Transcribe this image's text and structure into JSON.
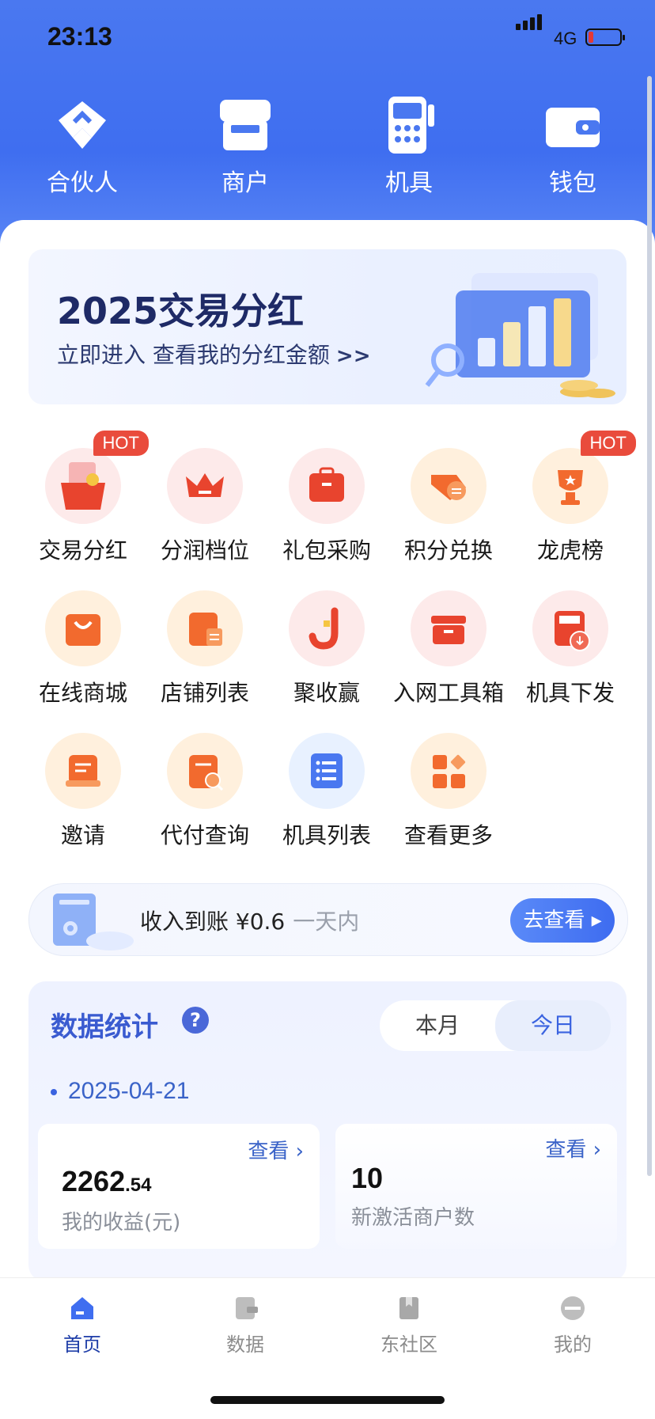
{
  "status_bar": {
    "time": "23:13",
    "network": "4G"
  },
  "top_nav": [
    {
      "label": "合伙人",
      "icon": "partner-icon"
    },
    {
      "label": "商户",
      "icon": "merchant-icon"
    },
    {
      "label": "机具",
      "icon": "pos-terminal-icon"
    },
    {
      "label": "钱包",
      "icon": "wallet-icon"
    }
  ],
  "banner": {
    "title": "2025交易分红",
    "subtitle": "立即进入 查看我的分红金额",
    "arrow": ">>"
  },
  "grid": [
    {
      "label": "交易分红",
      "badge": "HOT",
      "icon": "red-envelope-icon"
    },
    {
      "label": "分润档位",
      "icon": "crown-icon"
    },
    {
      "label": "礼包采购",
      "icon": "gift-bag-icon"
    },
    {
      "label": "积分兑换",
      "icon": "exchange-icon"
    },
    {
      "label": "龙虎榜",
      "badge": "HOT",
      "icon": "trophy-icon"
    },
    {
      "label": "在线商城",
      "icon": "shopping-bag-icon"
    },
    {
      "label": "店铺列表",
      "icon": "store-list-icon"
    },
    {
      "label": "聚收赢",
      "icon": "j-logo-icon"
    },
    {
      "label": "入网工具箱",
      "icon": "toolbox-icon"
    },
    {
      "label": "机具下发",
      "icon": "device-dispatch-icon"
    },
    {
      "label": "邀请",
      "icon": "invite-icon"
    },
    {
      "label": "代付查询",
      "icon": "payment-query-icon"
    },
    {
      "label": "机具列表",
      "icon": "device-list-icon"
    },
    {
      "label": "查看更多",
      "icon": "more-apps-icon"
    }
  ],
  "notice": {
    "text": "收入到账 ¥0.6",
    "sub": "一天内",
    "button": "去查看"
  },
  "stats": {
    "title": "数据统计",
    "help": "?",
    "tabs": [
      "本月",
      "今日"
    ],
    "selected_tab": "今日",
    "date": "2025-04-21",
    "cards": [
      {
        "value_int": "2262",
        "value_dec": ".54",
        "caption": "我的收益(元)",
        "link": "查看"
      },
      {
        "value_int": "10",
        "value_dec": "",
        "caption": "新激活商户数",
        "link": "查看"
      }
    ]
  },
  "tab_bar": [
    {
      "label": "首页",
      "icon": "home-icon",
      "active": true
    },
    {
      "label": "数据",
      "icon": "data-icon",
      "active": false
    },
    {
      "label": "东社区",
      "icon": "community-icon",
      "active": false
    },
    {
      "label": "我的",
      "icon": "profile-icon",
      "active": false
    }
  ],
  "colors": {
    "primary": "#3f6ef0",
    "hot": "#e94b3c",
    "accent_orange": "#f26a2e"
  }
}
